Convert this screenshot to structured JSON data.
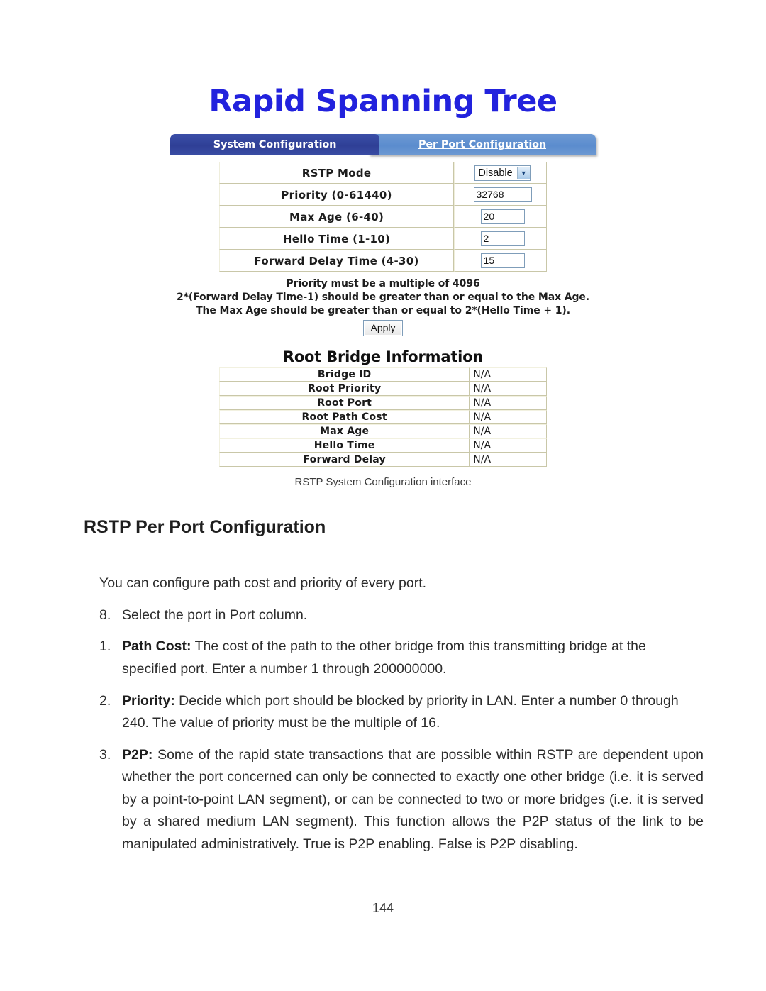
{
  "figure": {
    "title": "Rapid Spanning Tree",
    "tabs": [
      {
        "label": "System Configuration",
        "state": "active"
      },
      {
        "label": "Per Port Configuration",
        "state": "inactive"
      }
    ],
    "config_table": {
      "rows": [
        {
          "label": "RSTP Mode",
          "value": "Disable",
          "control": "select"
        },
        {
          "label": "Priority (0-61440)",
          "value": "32768",
          "control": "text"
        },
        {
          "label": "Max Age (6-40)",
          "value": "20",
          "control": "text"
        },
        {
          "label": "Hello Time (1-10)",
          "value": "2",
          "control": "text"
        },
        {
          "label": "Forward Delay Time (4-30)",
          "value": "15",
          "control": "text"
        }
      ]
    },
    "notes": [
      "Priority must be a multiple of 4096",
      "2*(Forward Delay Time-1) should be greater than or equal to the Max Age.",
      "The Max Age should be greater than or equal to 2*(Hello Time + 1)."
    ],
    "apply_label": "Apply",
    "root_bridge": {
      "heading": "Root Bridge Information",
      "rows": [
        {
          "label": "Bridge ID",
          "value": "N/A"
        },
        {
          "label": "Root Priority",
          "value": "N/A"
        },
        {
          "label": "Root Port",
          "value": "N/A"
        },
        {
          "label": "Root Path Cost",
          "value": "N/A"
        },
        {
          "label": "Max Age",
          "value": "N/A"
        },
        {
          "label": "Hello Time",
          "value": "N/A"
        },
        {
          "label": "Forward Delay",
          "value": "N/A"
        }
      ]
    },
    "caption": "RSTP System Configuration interface"
  },
  "document": {
    "section_heading": "RSTP Per Port Configuration",
    "intro": "You can configure path cost and priority of every port.",
    "items": [
      {
        "num": "8.",
        "bold": "",
        "text": "Select the port in Port column."
      },
      {
        "num": "1.",
        "bold": "Path Cost:",
        "text": " The cost of the path to the other bridge from this transmitting bridge at the specified port. Enter a number 1 through 200000000."
      },
      {
        "num": "2.",
        "bold": "Priority:",
        "text": " Decide which port should be blocked by priority in LAN. Enter a number 0 through 240. The value of priority must be the multiple of 16."
      },
      {
        "num": "3.",
        "bold": "P2P:",
        "text": " Some of the rapid state transactions that are possible within RSTP are dependent upon whether the port concerned can only be connected to exactly one other bridge (i.e. it is served by a point-to-point LAN segment), or can be connected to two or more bridges (i.e. it is served by a shared medium LAN segment). This function allows the P2P status of the link to be manipulated administratively. True is P2P enabling. False is P2P disabling."
      }
    ],
    "page_number": "144"
  },
  "colors": {
    "title_blue": "#2222dd",
    "tab_active": "#2f3f96",
    "tab_inactive": "#5b8cce",
    "table_border": "#c9c7a8",
    "input_border": "#7f9db9"
  }
}
